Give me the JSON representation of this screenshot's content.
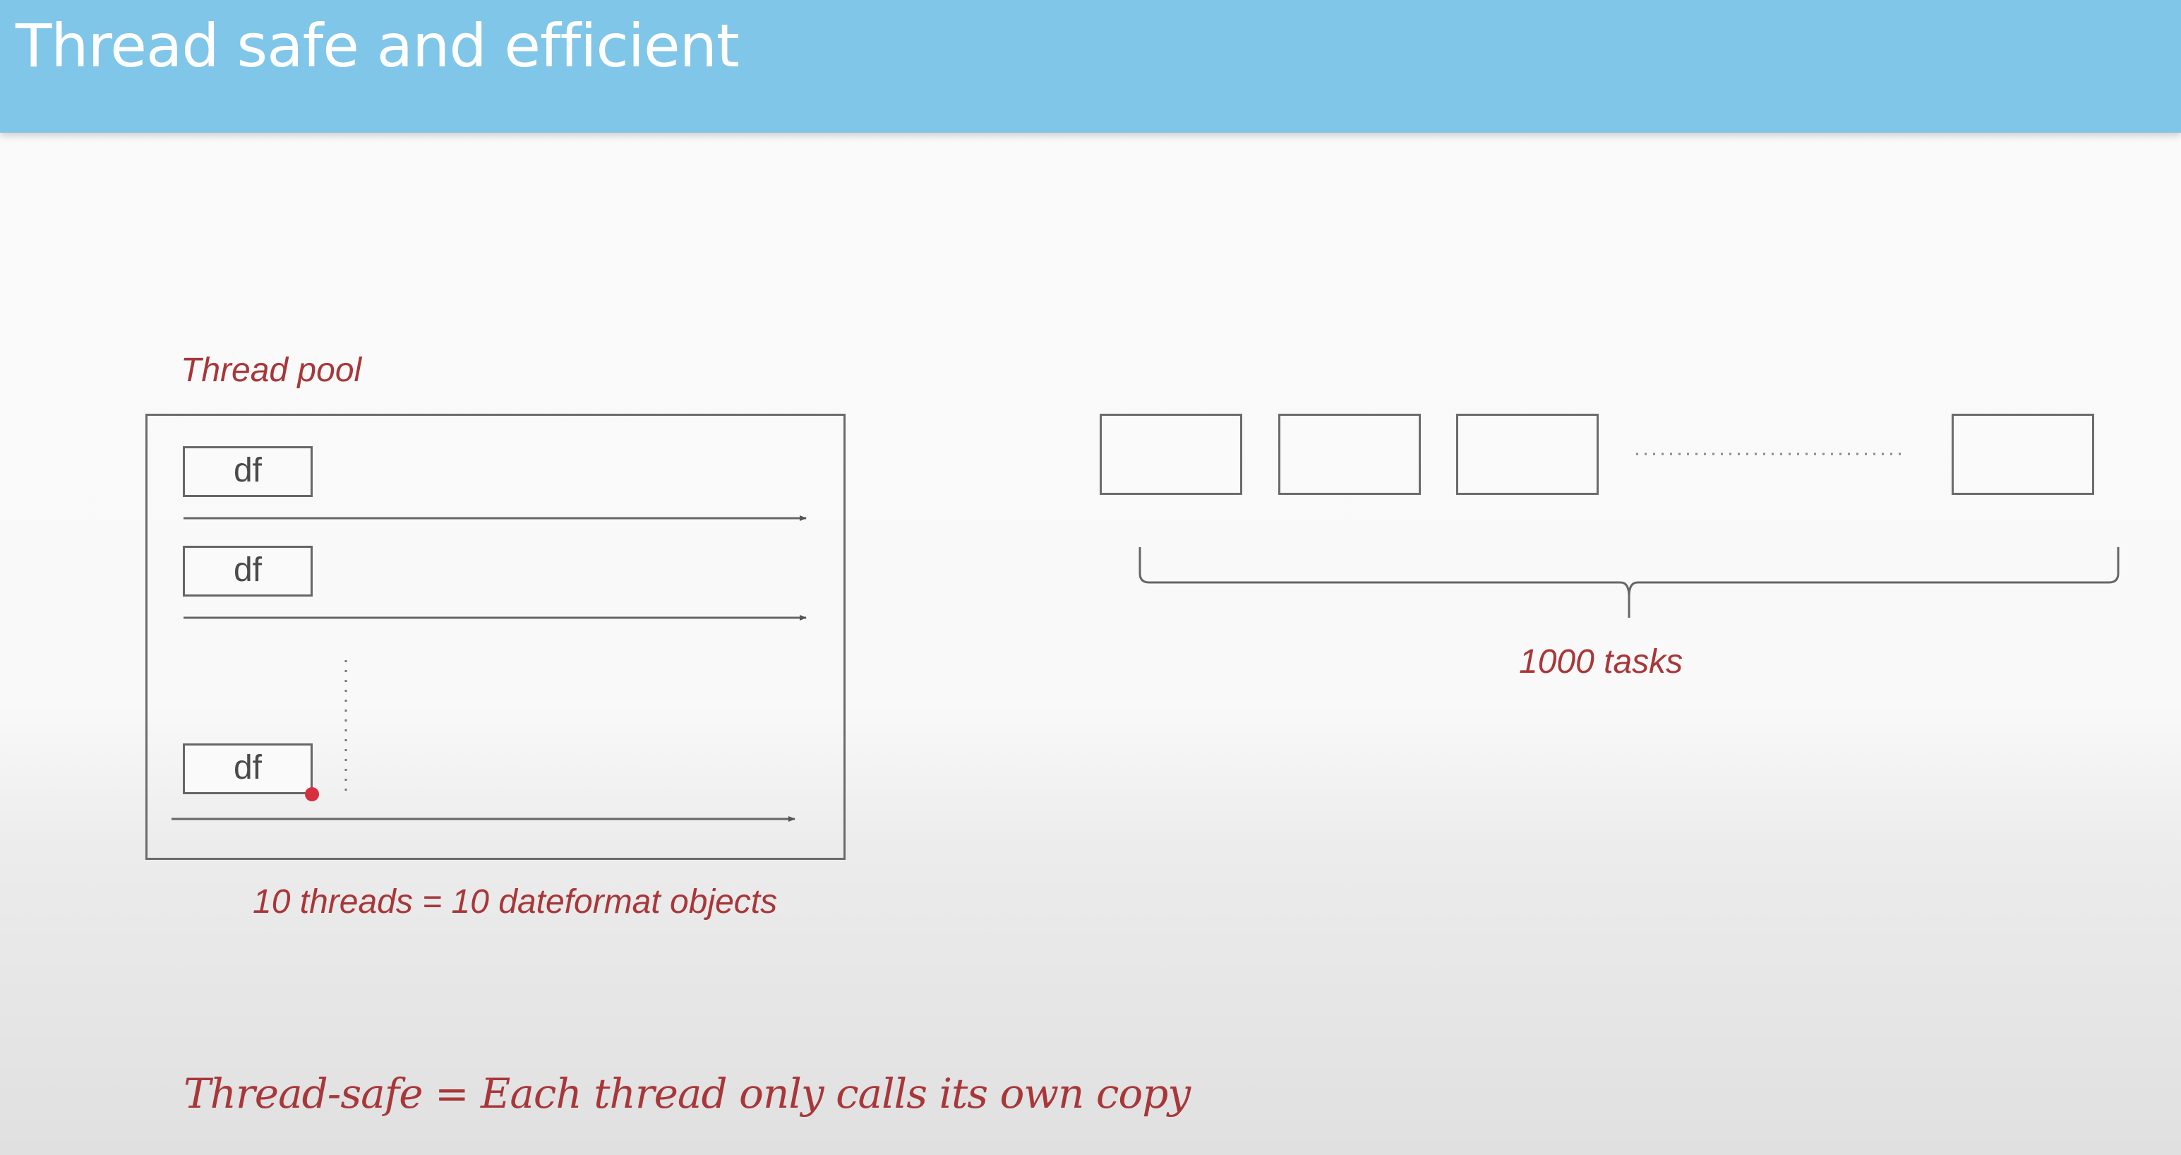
{
  "header": {
    "title": "Thread safe and efficient"
  },
  "thread_pool": {
    "label": "Thread pool",
    "threads": [
      {
        "label": "df"
      },
      {
        "label": "df"
      },
      {
        "label": "df"
      }
    ],
    "caption": "10 threads = 10 dateformat objects"
  },
  "tasks": {
    "label": "1000 tasks"
  },
  "footer": {
    "note": "Thread-safe = Each thread only calls its own copy"
  },
  "colors": {
    "header_bg": "#80c6e8",
    "accent_red": "#a8373a",
    "marker_dot": "#d62f3f",
    "line": "#6b6b6b"
  }
}
